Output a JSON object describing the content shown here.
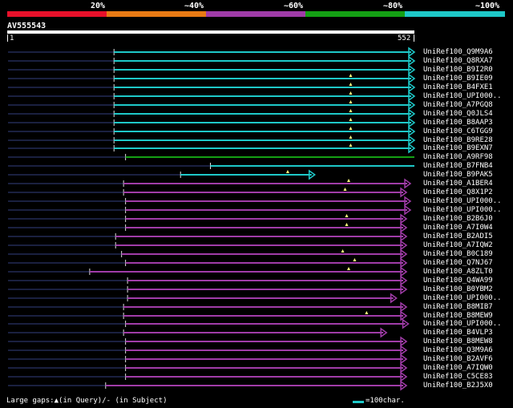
{
  "scale": {
    "percent_labels": [
      "20%",
      "~40%",
      "~60%",
      "~80%",
      "~100%"
    ],
    "colors": [
      "#e8102a",
      "#e87a14",
      "#a03ca8",
      "#14a014",
      "#1ec8c8"
    ]
  },
  "query": {
    "id": "AV555543",
    "start": "1",
    "end": "552",
    "length": 552
  },
  "hits": [
    {
      "label": "UniRef100_Q9M9A6",
      "color": "#1ec8c8",
      "start": 266,
      "end": 1020,
      "arrow": true,
      "gaps_query": []
    },
    {
      "label": "UniRef100_Q8RXA7",
      "color": "#1ec8c8",
      "start": 266,
      "end": 1020,
      "arrow": true,
      "gaps_query": []
    },
    {
      "label": "UniRef100_B9I2R0",
      "color": "#1ec8c8",
      "start": 266,
      "end": 1020,
      "arrow": true,
      "gaps_query": []
    },
    {
      "label": "UniRef100_B9IE09",
      "color": "#1ec8c8",
      "start": 266,
      "end": 1020,
      "arrow": true,
      "gaps_query": [
        860
      ]
    },
    {
      "label": "UniRef100_B4FXE1",
      "color": "#1ec8c8",
      "start": 266,
      "end": 1020,
      "arrow": true,
      "gaps_query": [
        860
      ]
    },
    {
      "label": "UniRef100_UPI000..",
      "color": "#1ec8c8",
      "start": 266,
      "end": 1020,
      "arrow": true,
      "gaps_query": [
        860
      ]
    },
    {
      "label": "UniRef100_A7PGQ8",
      "color": "#1ec8c8",
      "start": 266,
      "end": 1020,
      "arrow": true,
      "gaps_query": [
        860
      ]
    },
    {
      "label": "UniRef100_Q0JLS4",
      "color": "#1ec8c8",
      "start": 266,
      "end": 1020,
      "arrow": true,
      "gaps_query": [
        860
      ]
    },
    {
      "label": "UniRef100_B8AAP3",
      "color": "#1ec8c8",
      "start": 266,
      "end": 1020,
      "arrow": true,
      "gaps_query": [
        860
      ]
    },
    {
      "label": "UniRef100_C6TGG9",
      "color": "#1ec8c8",
      "start": 266,
      "end": 1020,
      "arrow": true,
      "gaps_query": [
        860
      ]
    },
    {
      "label": "UniRef100_B9RE28",
      "color": "#1ec8c8",
      "start": 266,
      "end": 1020,
      "arrow": true,
      "gaps_query": [
        860
      ]
    },
    {
      "label": "UniRef100_B9EXN7",
      "color": "#1ec8c8",
      "start": 266,
      "end": 1020,
      "arrow": true,
      "gaps_query": [
        860
      ]
    },
    {
      "label": "UniRef100_A9RF98",
      "color": "#14a014",
      "start": 295,
      "end": 1020,
      "arrow": false,
      "gaps_query": []
    },
    {
      "label": "UniRef100_B7FNB4",
      "color": "#1ec8c8",
      "start": 508,
      "end": 1020,
      "arrow": false,
      "gaps_query": []
    },
    {
      "label": "UniRef100_B9PAK5",
      "color": "#1ec8c8",
      "start": 433,
      "end": 770,
      "arrow": true,
      "gaps_query": [
        702
      ]
    },
    {
      "label": "UniRef100_A1BER4",
      "color": "#a03ca8",
      "start": 290,
      "end": 1010,
      "arrow": true,
      "gaps_query": [
        855
      ]
    },
    {
      "label": "UniRef100_Q8X1P2",
      "color": "#a03ca8",
      "start": 290,
      "end": 1000,
      "arrow": true,
      "gaps_query": [
        846
      ]
    },
    {
      "label": "UniRef100_UPI000..",
      "color": "#a03ca8",
      "start": 295,
      "end": 1010,
      "arrow": true,
      "gaps_query": []
    },
    {
      "label": "UniRef100_UPI000..",
      "color": "#a03ca8",
      "start": 295,
      "end": 1010,
      "arrow": true,
      "gaps_query": []
    },
    {
      "label": "UniRef100_B2B6J0",
      "color": "#a03ca8",
      "start": 295,
      "end": 1000,
      "arrow": true,
      "gaps_query": [
        850
      ]
    },
    {
      "label": "UniRef100_A7I0W4",
      "color": "#a03ca8",
      "start": 295,
      "end": 1000,
      "arrow": true,
      "gaps_query": [
        850
      ]
    },
    {
      "label": "UniRef100_B2ADI5",
      "color": "#a03ca8",
      "start": 270,
      "end": 1000,
      "arrow": true,
      "gaps_query": []
    },
    {
      "label": "UniRef100_A7IQW2",
      "color": "#a03ca8",
      "start": 270,
      "end": 1000,
      "arrow": true,
      "gaps_query": []
    },
    {
      "label": "UniRef100_B0C189",
      "color": "#a03ca8",
      "start": 285,
      "end": 1000,
      "arrow": true,
      "gaps_query": [
        840
      ]
    },
    {
      "label": "UniRef100_Q7NJ67",
      "color": "#a03ca8",
      "start": 295,
      "end": 1000,
      "arrow": true,
      "gaps_query": [
        870
      ]
    },
    {
      "label": "UniRef100_A8ZLT0",
      "color": "#a03ca8",
      "start": 205,
      "end": 1000,
      "arrow": true,
      "gaps_query": [
        855
      ]
    },
    {
      "label": "UniRef100_Q4WA99",
      "color": "#a03ca8",
      "start": 300,
      "end": 1000,
      "arrow": true,
      "gaps_query": []
    },
    {
      "label": "UniRef100_B0YBM2",
      "color": "#a03ca8",
      "start": 300,
      "end": 1000,
      "arrow": true,
      "gaps_query": []
    },
    {
      "label": "UniRef100_UPI000..",
      "color": "#a03ca8",
      "start": 300,
      "end": 975,
      "arrow": true,
      "gaps_query": []
    },
    {
      "label": "UniRef100_B8MIB7",
      "color": "#a03ca8",
      "start": 290,
      "end": 1000,
      "arrow": true,
      "gaps_query": []
    },
    {
      "label": "UniRef100_B8MEW9",
      "color": "#a03ca8",
      "start": 290,
      "end": 1000,
      "arrow": true,
      "gaps_query": [
        900
      ]
    },
    {
      "label": "UniRef100_UPI000..",
      "color": "#a03ca8",
      "start": 295,
      "end": 1005,
      "arrow": true,
      "gaps_query": []
    },
    {
      "label": "UniRef100_B4VLP3",
      "color": "#a03ca8",
      "start": 290,
      "end": 950,
      "arrow": true,
      "gaps_query": []
    },
    {
      "label": "UniRef100_B8MEW8",
      "color": "#a03ca8",
      "start": 295,
      "end": 1000,
      "arrow": true,
      "gaps_query": []
    },
    {
      "label": "UniRef100_Q3M9A6",
      "color": "#a03ca8",
      "start": 295,
      "end": 1000,
      "arrow": true,
      "gaps_query": []
    },
    {
      "label": "UniRef100_B2AVF6",
      "color": "#a03ca8",
      "start": 295,
      "end": 1000,
      "arrow": true,
      "gaps_query": []
    },
    {
      "label": "UniRef100_A7IQW0",
      "color": "#a03ca8",
      "start": 295,
      "end": 1000,
      "arrow": true,
      "gaps_query": []
    },
    {
      "label": "UniRef100_C5CE83",
      "color": "#a03ca8",
      "start": 295,
      "end": 1000,
      "arrow": true,
      "gaps_query": []
    },
    {
      "label": "UniRef100_B2J5X0",
      "color": "#a03ca8",
      "start": 245,
      "end": 1000,
      "arrow": true,
      "gaps_query": []
    }
  ],
  "footer": {
    "text": "Large gaps:▲(in Query)/- (in Subject)",
    "legend_text": "=100char."
  }
}
